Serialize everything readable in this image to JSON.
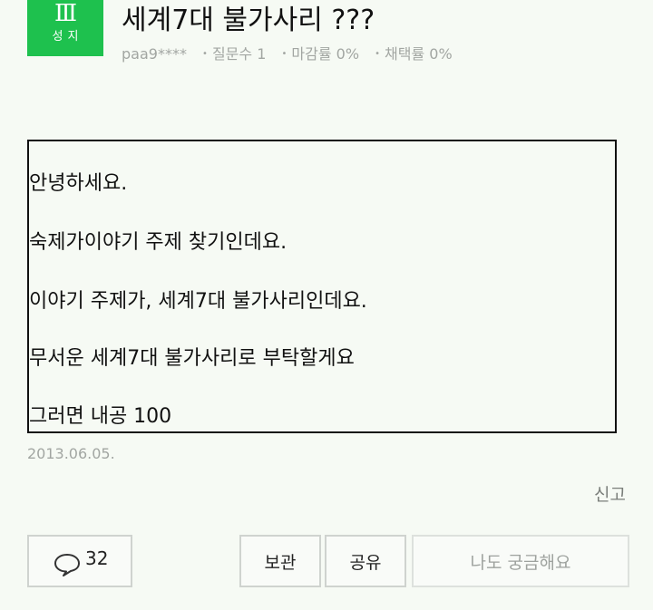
{
  "badge": {
    "roman": "Ⅲ",
    "label": "성지"
  },
  "question": {
    "title": "세계7대 불가사리 ???",
    "author": "paa9****",
    "stats": {
      "questions": "질문수 1",
      "close_rate": "마감률 0%",
      "adopt_rate": "채택률 0%"
    },
    "body": [
      "안녕하세요.",
      "숙제가이야기 주제 찾기인데요.",
      "이야기 주제가, 세계7대 불가사리인데요.",
      "무서운 세계7대 불가사리로 부탁할게요",
      "그러면 내공 100"
    ],
    "date": "2013.06.05."
  },
  "actions": {
    "report_label": "신고",
    "comment_count": "32",
    "save_label": "보관",
    "share_label": "공유",
    "curious_label": "나도 궁금해요"
  }
}
